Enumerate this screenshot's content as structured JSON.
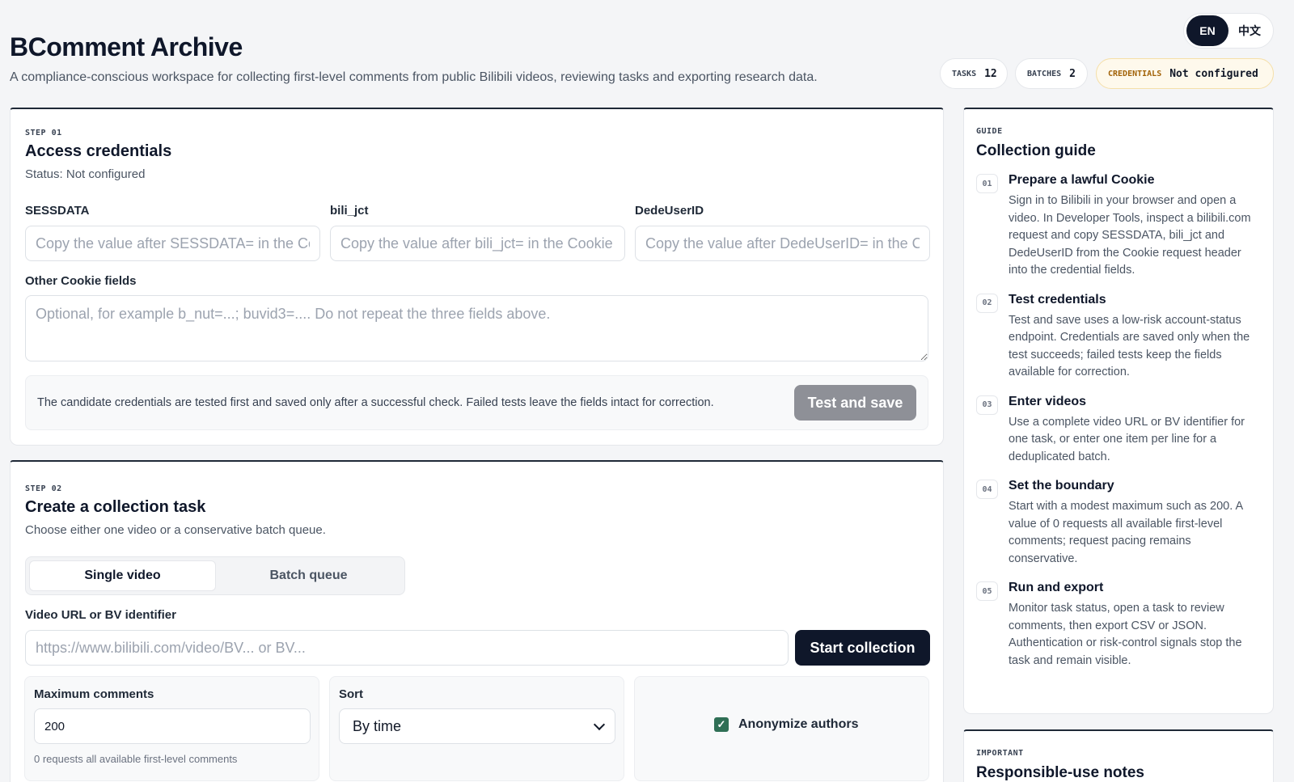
{
  "header": {
    "title": "BComment Archive",
    "subtitle": "A compliance-conscious workspace for collecting first-level comments from public Bilibili videos, reviewing tasks and exporting research data."
  },
  "language": {
    "en": "EN",
    "zh": "中文",
    "active": "EN"
  },
  "stats": {
    "tasks_label": "TASKS",
    "tasks_value": "12",
    "batches_label": "BATCHES",
    "batches_value": "2",
    "credentials_label": "CREDENTIALS",
    "credentials_value": "Not configured"
  },
  "step1": {
    "step": "STEP 01",
    "title": "Access credentials",
    "status": "Status: Not configured",
    "sessdata_label": "SESSDATA",
    "sessdata_placeholder": "Copy the value after SESSDATA= in the Cookie header",
    "bili_jct_label": "bili_jct",
    "bili_jct_placeholder": "Copy the value after bili_jct= in the Cookie header",
    "dedeuserid_label": "DedeUserID",
    "dedeuserid_placeholder": "Copy the value after DedeUserID= in the Cookie header",
    "other_label": "Other Cookie fields",
    "other_placeholder": "Optional, for example b_nut=...; buvid3=.... Do not repeat the three fields above.",
    "notice": "The candidate credentials are tested first and saved only after a successful check. Failed tests leave the fields intact for correction.",
    "test_save": "Test and save"
  },
  "step2": {
    "step": "STEP 02",
    "title": "Create a collection task",
    "desc": "Choose either one video or a conservative batch queue.",
    "tab_single": "Single video",
    "tab_batch": "Batch queue",
    "url_label": "Video URL or BV identifier",
    "url_placeholder": "https://www.bilibili.com/video/BV... or BV...",
    "start": "Start collection",
    "max_label": "Maximum comments",
    "max_value": "200",
    "max_hint": "0 requests all available first-level comments",
    "sort_label": "Sort",
    "sort_value": "By time",
    "anonymize_label": "Anonymize authors",
    "anonymize_checked": true
  },
  "guide": {
    "label": "GUIDE",
    "title": "Collection guide",
    "items": [
      {
        "num": "01",
        "title": "Prepare a lawful Cookie",
        "text": "Sign in to Bilibili in your browser and open a video. In Developer Tools, inspect a bilibili.com request and copy SESSDATA, bili_jct and DedeUserID from the Cookie request header into the credential fields."
      },
      {
        "num": "02",
        "title": "Test credentials",
        "text": "Test and save uses a low-risk account-status endpoint. Credentials are saved only when the test succeeds; failed tests keep the fields available for correction."
      },
      {
        "num": "03",
        "title": "Enter videos",
        "text": "Use a complete video URL or BV identifier for one task, or enter one item per line for a deduplicated batch."
      },
      {
        "num": "04",
        "title": "Set the boundary",
        "text": "Start with a modest maximum such as 200. A value of 0 requests all available first-level comments; request pacing remains conservative."
      },
      {
        "num": "05",
        "title": "Run and export",
        "text": "Monitor task status, open a task to review comments, then export CSV or JSON. Authentication or risk-control signals stop the task and remain visible."
      }
    ]
  },
  "important": {
    "label": "IMPORTANT",
    "title": "Responsible-use notes"
  }
}
